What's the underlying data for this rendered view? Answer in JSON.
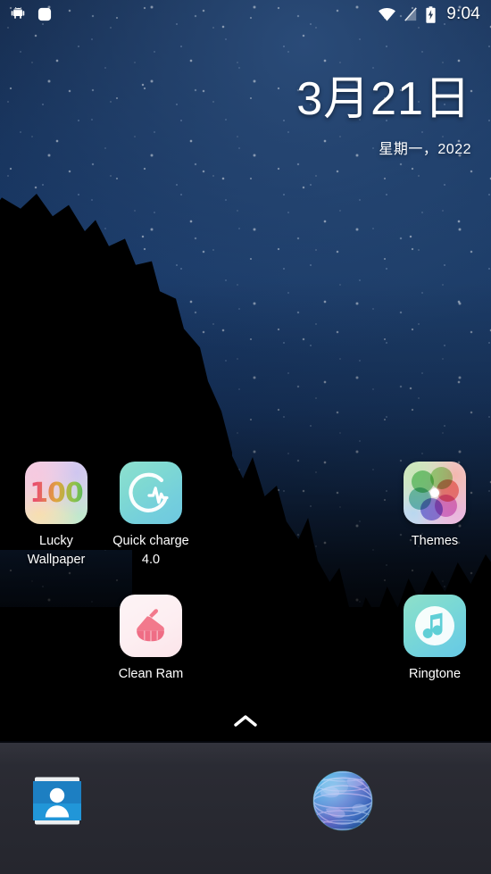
{
  "status_bar": {
    "left_icons": [
      {
        "name": "android-robot-icon",
        "glyph": "android"
      },
      {
        "name": "white-square-notification-icon",
        "glyph": "rounded-square"
      }
    ],
    "right_icons": [
      {
        "name": "wifi-icon",
        "glyph": "wifi"
      },
      {
        "name": "no-sim-signal-icon",
        "glyph": "signal-off"
      },
      {
        "name": "battery-charging-icon",
        "glyph": "battery-bolt"
      }
    ],
    "clock": "9:04"
  },
  "date_widget": {
    "date": "3月21日",
    "weekday_year": "星期一，2022"
  },
  "home_screen": {
    "apps": [
      {
        "name": "lucky-wallpaper",
        "label": "Lucky\nWallpaper",
        "icon": "hundred-icon",
        "badge_text": "100"
      },
      {
        "name": "quick-charge",
        "label": "Quick charge\n4.0",
        "icon": "charge-pulse-icon"
      },
      {
        "name": "themes",
        "label": "Themes",
        "icon": "flower-petals-icon"
      },
      {
        "name": "clean-ram",
        "label": "Clean Ram",
        "icon": "broom-icon"
      },
      {
        "name": "ringtone",
        "label": "Ringtone",
        "icon": "music-note-icon"
      }
    ],
    "drawer_indicator": "chevron-up-icon"
  },
  "dock": {
    "apps": [
      {
        "name": "contacts",
        "icon": "contacts-card-icon"
      },
      {
        "name": "browser",
        "icon": "globe-icon"
      }
    ]
  },
  "colors": {
    "accent_blue": "#2196d8",
    "dock_background": "#2a2b33",
    "status_text": "#ffffff",
    "sky_top": "#14294a",
    "sky_mid": "#1a3a68"
  }
}
